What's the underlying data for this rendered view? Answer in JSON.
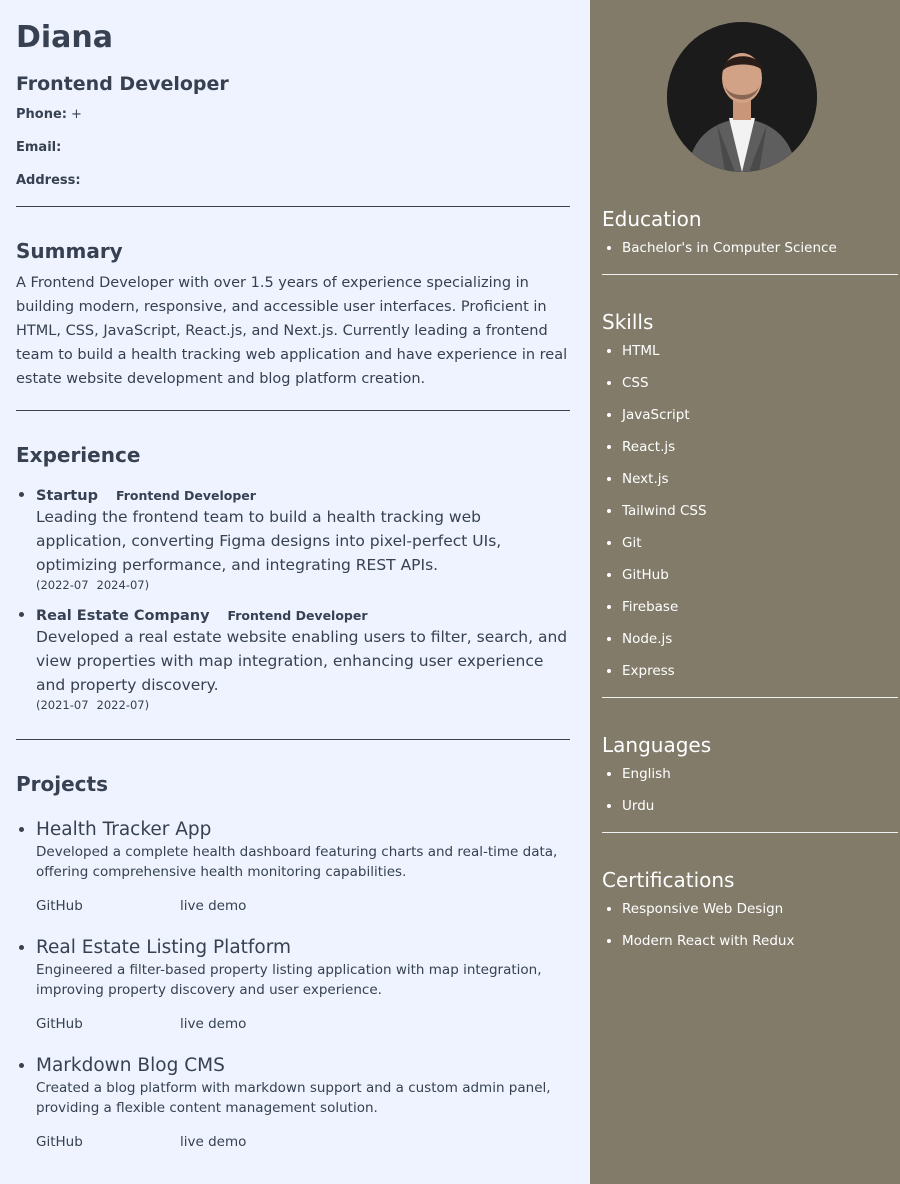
{
  "header": {
    "name": "Diana",
    "role": "Frontend Developer",
    "phone_label": "Phone:",
    "phone_value": "+",
    "email_label": "Email:",
    "address_label": "Address:"
  },
  "summary": {
    "title": "Summary",
    "text": "A Frontend Developer with over 1.5 years of experience specializing in building modern, responsive, and accessible user interfaces. Proficient in HTML, CSS, JavaScript, React.js, and Next.js. Currently leading a frontend team to build a health tracking web application and have experience in real estate website development and blog platform creation."
  },
  "experience": {
    "title": "Experience",
    "items": [
      {
        "company": "Startup",
        "position": "Frontend Developer",
        "description": "Leading the frontend team to build a health tracking web application, converting Figma designs into pixel-perfect UIs, optimizing performance, and integrating REST APIs.",
        "start": "(2022-07",
        "end": "2024-07)"
      },
      {
        "company": "Real Estate Company",
        "position": "Frontend Developer",
        "description": "Developed a real estate website enabling users to filter, search, and view properties with map integration, enhancing user experience and property discovery.",
        "start": "(2021-07",
        "end": "2022-07)"
      }
    ]
  },
  "projects": {
    "title": "Projects",
    "items": [
      {
        "title": "Health Tracker App",
        "description": "Developed a complete health dashboard featuring charts and real-time data, offering comprehensive health monitoring capabilities.",
        "github_label": "GitHub",
        "demo_label": "live demo"
      },
      {
        "title": "Real Estate Listing Platform",
        "description": "Engineered a filter-based property listing application with map integration, improving property discovery and user experience.",
        "github_label": "GitHub",
        "demo_label": "live demo"
      },
      {
        "title": "Markdown Blog CMS",
        "description": "Created a blog platform with markdown support and a custom admin panel, providing a flexible content management solution.",
        "github_label": "GitHub",
        "demo_label": "live demo"
      }
    ]
  },
  "sidebar": {
    "education": {
      "title": "Education",
      "items": [
        "Bachelor's in Computer Science"
      ]
    },
    "skills": {
      "title": "Skills",
      "items": [
        "HTML",
        "CSS",
        "JavaScript",
        "React.js",
        "Next.js",
        "Tailwind CSS",
        "Git",
        "GitHub",
        "Firebase",
        "Node.js",
        "Express"
      ]
    },
    "languages": {
      "title": "Languages",
      "items": [
        "English",
        "Urdu"
      ]
    },
    "certifications": {
      "title": "Certifications",
      "items": [
        "Responsive Web Design",
        "Modern React with Redux"
      ]
    }
  },
  "colors": {
    "main_bg": "#eef3ff",
    "sidebar_bg": "#827b6a",
    "text": "#374151"
  }
}
